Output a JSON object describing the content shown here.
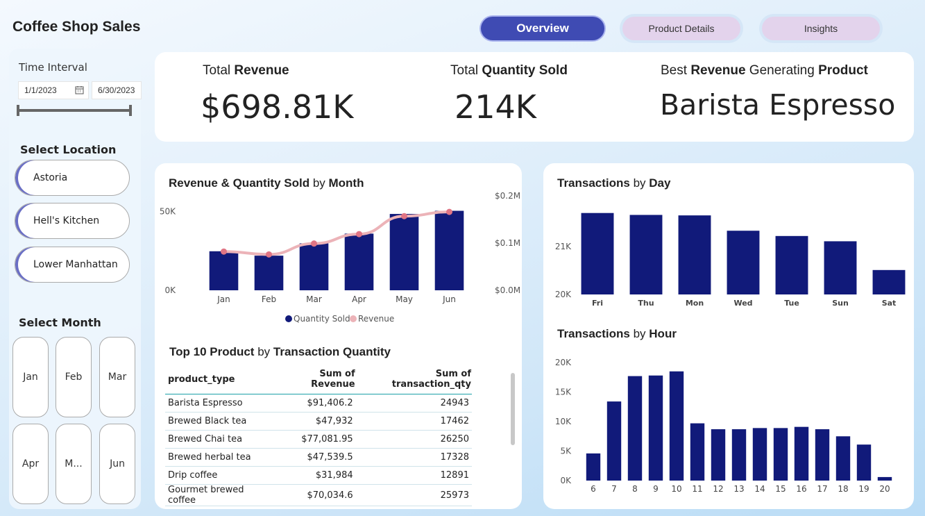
{
  "app": {
    "title": "Coffee Shop Sales"
  },
  "nav": {
    "overview": "Overview",
    "product_details": "Product Details",
    "insights": "Insights"
  },
  "sidebar": {
    "time_interval": "Time Interval",
    "start_date": "1/1/2023",
    "end_date": "6/30/2023",
    "select_location": "Select Location",
    "locations": [
      "Astoria",
      "Hell's Kitchen",
      "Lower Manhattan"
    ],
    "select_month": "Select Month",
    "months": [
      "Jan",
      "Feb",
      "Mar",
      "Apr",
      "M...",
      "Jun"
    ]
  },
  "kpis": {
    "total_revenue_label_a": "Total ",
    "total_revenue_label_b": "Revenue",
    "total_revenue_value": "$698.81K",
    "total_qty_label_a": "Total ",
    "total_qty_label_b": "Quantity Sold",
    "total_qty_value": "214K",
    "best_label_a": "Best ",
    "best_label_b": "Revenue",
    "best_label_c": " Generating ",
    "best_label_d": "Product",
    "best_value": "Barista Espresso"
  },
  "monthly_panel": {
    "title_a": "Revenue & Quantity Sold",
    "title_b": " by ",
    "title_c": "Month"
  },
  "day_panel": {
    "title_a": "Transactions",
    "title_b": " by ",
    "title_c": "Day"
  },
  "hour_panel": {
    "title_a": "Transactions",
    "title_b": " by ",
    "title_c": "Hour"
  },
  "top_table": {
    "title_a": "Top 10 Product",
    "title_b": " by ",
    "title_c": "Transaction Quantity",
    "columns": [
      "product_type",
      "Sum of Revenue",
      "Sum of transaction_qty"
    ],
    "rows": [
      [
        "Barista Espresso",
        "$91,406.2",
        "24943"
      ],
      [
        "Brewed Black tea",
        "$47,932",
        "17462"
      ],
      [
        "Brewed Chai tea",
        "$77,081.95",
        "26250"
      ],
      [
        "Brewed herbal tea",
        "$47,539.5",
        "17328"
      ],
      [
        "Drip coffee",
        "$31,984",
        "12891"
      ],
      [
        "Gourmet brewed coffee",
        "$70,034.6",
        "25973"
      ]
    ]
  },
  "colors": {
    "bar": "#111a7a",
    "line": "#ecb3b8",
    "line_point": "#e07585",
    "accent": "#3f4bb3"
  },
  "chart_data": [
    {
      "type": "bar",
      "title": "Revenue & Quantity Sold by Month",
      "categories": [
        "Jan",
        "Feb",
        "Mar",
        "Apr",
        "May",
        "Jun"
      ],
      "series": [
        {
          "name": "Quantity Sold",
          "type": "bar",
          "axis": "left",
          "values": [
            24800,
            22000,
            29800,
            36000,
            48500,
            50500
          ]
        },
        {
          "name": "Revenue",
          "type": "line",
          "axis": "right",
          "values": [
            0.082,
            0.076,
            0.099,
            0.119,
            0.157,
            0.166
          ]
        }
      ],
      "left_ticks": [
        "50K",
        "0K"
      ],
      "left_tick_values": [
        50000,
        0
      ],
      "left_ylim": [
        0,
        60000
      ],
      "right_ticks": [
        "$0.2M",
        "$0.1M",
        "$0.0M"
      ],
      "right_tick_values": [
        0.2,
        0.1,
        0.0
      ],
      "right_ylim": [
        0,
        0.2
      ],
      "legend": [
        "Quantity Sold",
        "Revenue"
      ],
      "legend_position": "bottom"
    },
    {
      "type": "bar",
      "title": "Transactions by Day",
      "categories": [
        "Fri",
        "Thu",
        "Mon",
        "Wed",
        "Tue",
        "Sun",
        "Sat"
      ],
      "values": [
        21700,
        21660,
        21650,
        21330,
        21220,
        21110,
        20510
      ],
      "ticks": [
        "21K",
        "20K"
      ],
      "tick_values": [
        21000,
        20000
      ],
      "ylim": [
        20000,
        21900
      ]
    },
    {
      "type": "bar",
      "title": "Transactions by Hour",
      "categories": [
        "6",
        "7",
        "8",
        "9",
        "10",
        "11",
        "12",
        "13",
        "14",
        "15",
        "16",
        "17",
        "18",
        "19",
        "20"
      ],
      "values": [
        4600,
        13400,
        17700,
        17800,
        18500,
        9700,
        8700,
        8700,
        8900,
        8900,
        9100,
        8700,
        7500,
        6100,
        600
      ],
      "ticks": [
        "20K",
        "15K",
        "10K",
        "5K",
        "0K"
      ],
      "tick_values": [
        20000,
        15000,
        10000,
        5000,
        0
      ],
      "ylim": [
        0,
        20000
      ]
    }
  ]
}
